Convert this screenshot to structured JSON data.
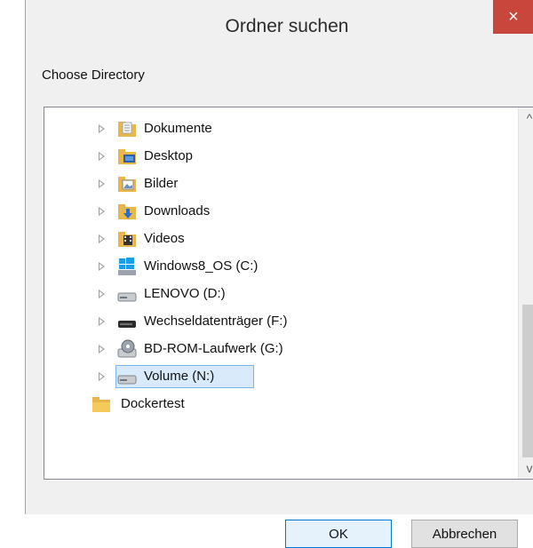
{
  "window": {
    "title": "Ordner suchen"
  },
  "dialog": {
    "label": "Choose Directory"
  },
  "tree": {
    "items": [
      {
        "label": "Dokumente",
        "icon": "documents-folder-icon",
        "expandable": true
      },
      {
        "label": "Desktop",
        "icon": "desktop-folder-icon",
        "expandable": true
      },
      {
        "label": "Bilder",
        "icon": "pictures-folder-icon",
        "expandable": true
      },
      {
        "label": "Downloads",
        "icon": "downloads-folder-icon",
        "expandable": true
      },
      {
        "label": "Videos",
        "icon": "videos-folder-icon",
        "expandable": true
      },
      {
        "label": "Windows8_OS (C:)",
        "icon": "windows-drive-icon",
        "expandable": true
      },
      {
        "label": "LENOVO (D:)",
        "icon": "hard-drive-icon",
        "expandable": true
      },
      {
        "label": "Wechseldatenträger (F:)",
        "icon": "removable-drive-icon",
        "expandable": true
      },
      {
        "label": "BD-ROM-Laufwerk (G:)",
        "icon": "optical-drive-icon",
        "expandable": true
      },
      {
        "label": "Volume (N:)",
        "icon": "hard-drive-icon",
        "expandable": true,
        "selected": true
      },
      {
        "label": "Dockertest",
        "icon": "folder-icon",
        "expandable": false
      }
    ]
  },
  "buttons": {
    "ok": "OK",
    "cancel": "Abbrechen"
  },
  "icons": {
    "close": "×",
    "scroll_up": "^",
    "scroll_down": "v"
  },
  "colors": {
    "close_button": "#c9463d",
    "selection_border": "#7ab4e8",
    "selection_fill": "#d9ebfa"
  }
}
